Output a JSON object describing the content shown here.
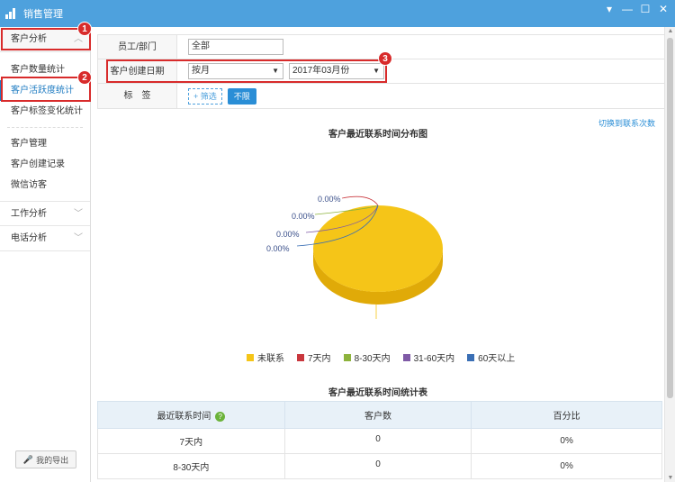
{
  "window": {
    "title": "销售管理",
    "controls": [
      "▾",
      "—",
      "☐",
      "✕"
    ]
  },
  "sidebar": {
    "section_customer": "客户分析",
    "items_analysis": [
      "客户数量统计",
      "客户活跃度统计",
      "客户标签变化统计"
    ],
    "items_manage": [
      "客户管理",
      "客户创建记录",
      "微信访客"
    ],
    "section_work": "工作分析",
    "section_phone": "电话分析",
    "export": "我的导出"
  },
  "badges": [
    "1",
    "2",
    "3"
  ],
  "filter": {
    "dept_label": "员工/部门",
    "dept_value": "全部",
    "date_label": "客户创建日期",
    "date_mode": "按月",
    "date_value": "2017年03月份",
    "tag_label": "标　签",
    "tag_filter": "+ 筛选",
    "tag_unlimited": "不限"
  },
  "switch_link": "切换到联系次数",
  "chart_data": {
    "type": "pie",
    "title": "客户最近联系时间分布图",
    "categories": [
      "未联系",
      "7天内",
      "8-30天内",
      "31-60天内",
      "60天以上"
    ],
    "values": [
      100,
      0,
      0,
      0,
      0
    ],
    "labels": [
      "100.00%",
      "0.00%",
      "0.00%",
      "0.00%",
      "0.00%"
    ],
    "colors": [
      "#f5c518",
      "#c9373d",
      "#8db33c",
      "#7f5aa6",
      "#3a6fb5"
    ],
    "legend": "bottom"
  },
  "table": {
    "title": "客户最近联系时间统计表",
    "headers": [
      "最近联系时间",
      "客户数",
      "百分比"
    ],
    "rows": [
      [
        "7天内",
        "0",
        "0%"
      ],
      [
        "8-30天内",
        "0",
        "0%"
      ]
    ]
  }
}
